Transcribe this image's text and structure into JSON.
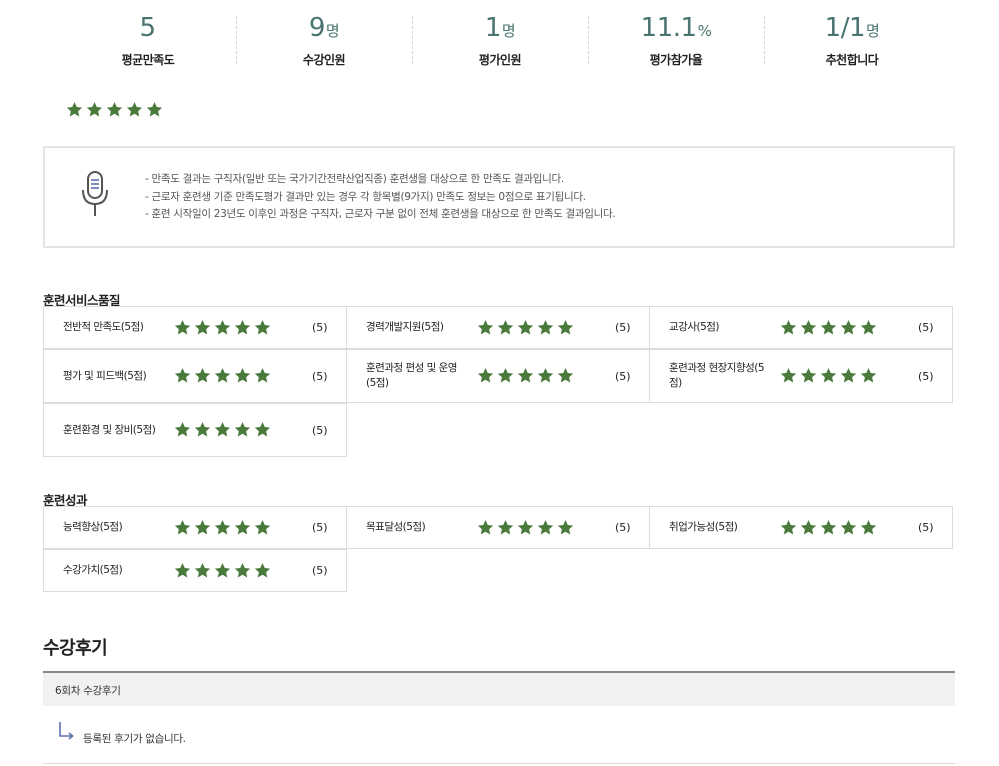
{
  "stats": [
    {
      "value": "5",
      "unit": "",
      "label": "평균만족도"
    },
    {
      "value": "9",
      "unit": "명",
      "label": "수강인원"
    },
    {
      "value": "1",
      "unit": "명",
      "label": "평가인원"
    },
    {
      "value": "11.1",
      "unit": "%",
      "label": "평가참가율"
    },
    {
      "value": "1/1",
      "unit": "명",
      "label": "추천합니다"
    }
  ],
  "average_rating": {
    "value": 5,
    "max": 5
  },
  "notice": {
    "lines": [
      "- 만족도 결과는 구직자(일반 또는 국가기간전략산업직종) 훈련생을 대상으로 한 만족도 결과입니다.",
      "- 근로자 훈련생 기준 만족도평가 결과만 있는 경우 각 항목별(9가지) 만족도 정보는 0점으로 표기됩니다.",
      "- 훈련 시작일이 23년도 이후인 과정은 구직자, 근로자 구분 없이 전체 훈련생을 대상으로 한 만족도 결과입니다."
    ]
  },
  "quality": {
    "title": "훈련서비스품질",
    "items": [
      {
        "name": "전반적 만족도(5점)",
        "rating": 5,
        "score": "(5)"
      },
      {
        "name": "경력개발지원(5점)",
        "rating": 5,
        "score": "(5)"
      },
      {
        "name": "교강사(5점)",
        "rating": 5,
        "score": "(5)"
      },
      {
        "name": "평가 및 피드백(5점)",
        "rating": 5,
        "score": "(5)"
      },
      {
        "name": "훈련과정 편성 및 운영(5점)",
        "rating": 5,
        "score": "(5)"
      },
      {
        "name": "훈련과정 현장지향성(5점)",
        "rating": 5,
        "score": "(5)"
      },
      {
        "name": "훈련환경 및 장비(5점)",
        "rating": 5,
        "score": "(5)"
      }
    ]
  },
  "outcome": {
    "title": "훈련성과",
    "items": [
      {
        "name": "능력향상(5점)",
        "rating": 5,
        "score": "(5)"
      },
      {
        "name": "목표달성(5점)",
        "rating": 5,
        "score": "(5)"
      },
      {
        "name": "취업가능성(5점)",
        "rating": 5,
        "score": "(5)"
      },
      {
        "name": "수강가치(5점)",
        "rating": 5,
        "score": "(5)"
      }
    ]
  },
  "reviews": {
    "title": "수강후기",
    "round_label": "6회차 수강후기",
    "empty_text": "등록된 후기가 없습니다."
  },
  "colors": {
    "star": "#4a7a3c",
    "stat": "#4a7470"
  },
  "icons": {
    "notice": "microphone-icon",
    "star": "star-icon",
    "reply": "reply-arrow-icon"
  }
}
